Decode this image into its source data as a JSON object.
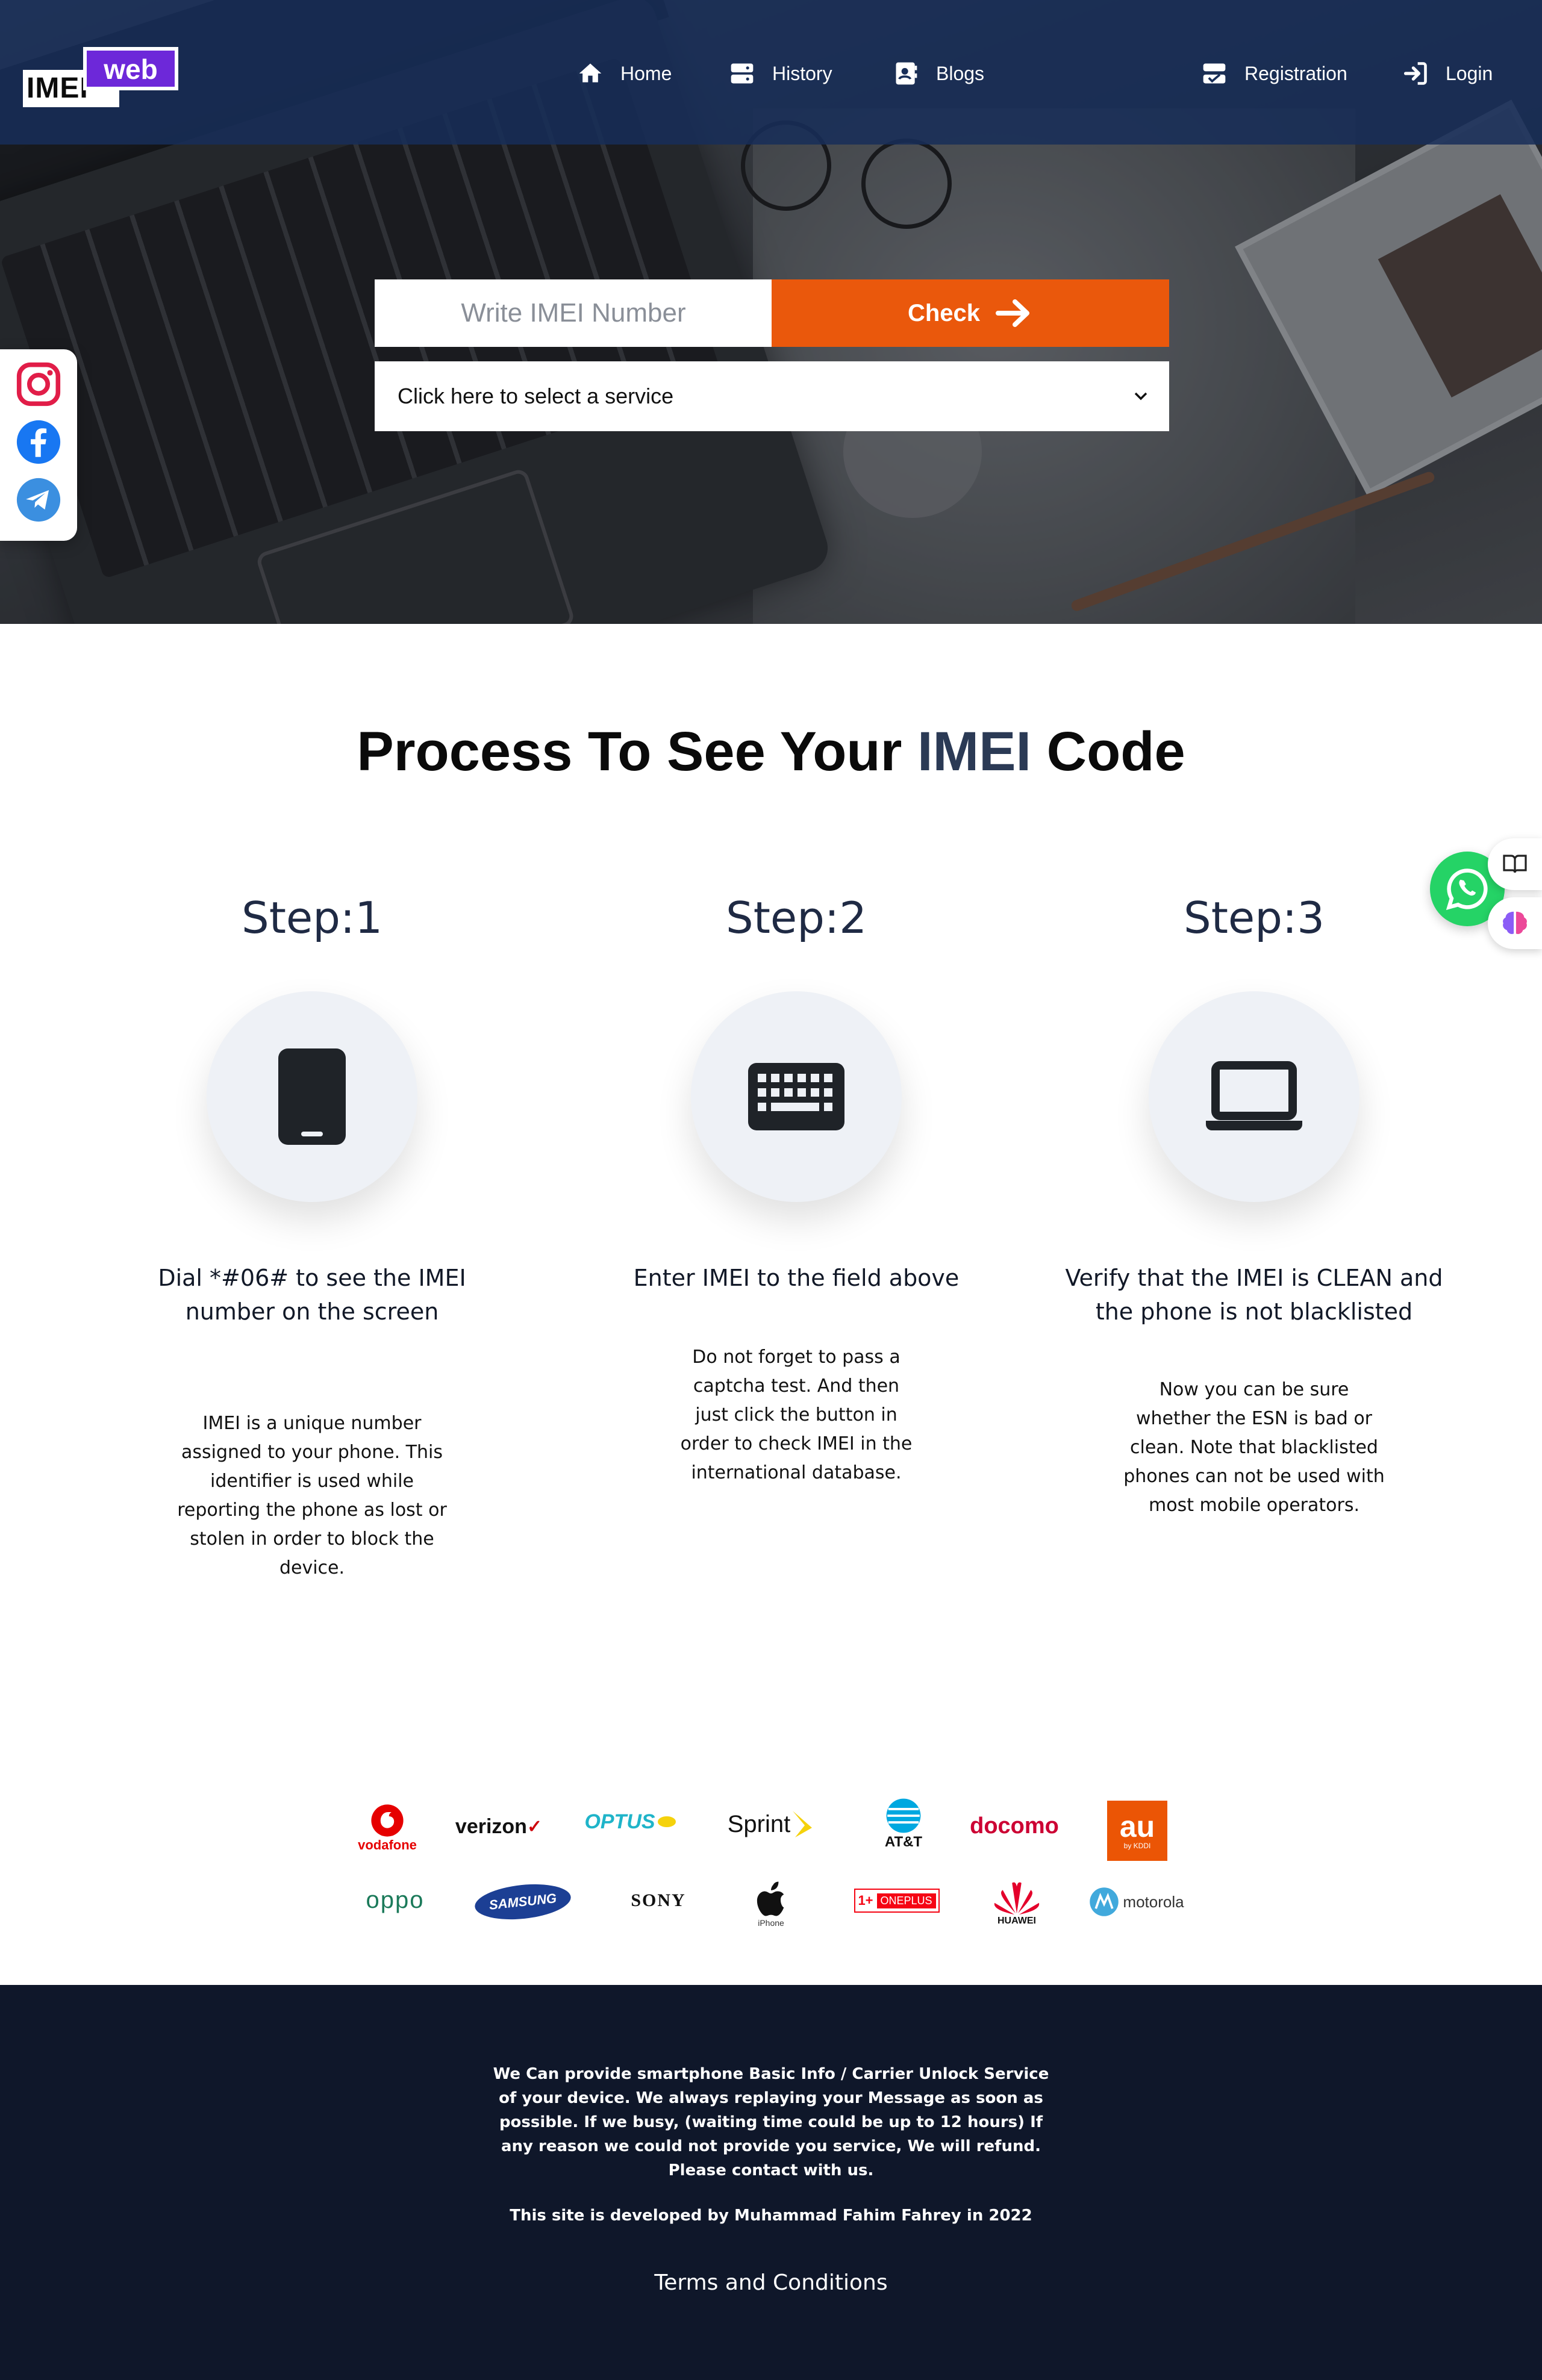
{
  "nav": {
    "logo_imei": "IMEI",
    "logo_web": "web",
    "home": "Home",
    "history": "History",
    "blogs": "Blogs",
    "registration": "Registration",
    "login": "Login"
  },
  "search": {
    "placeholder": "Write IMEI Number",
    "check_label": "Check",
    "service_placeholder": "Click here to select a service"
  },
  "social": [
    "instagram-icon",
    "facebook-icon",
    "telegram-icon"
  ],
  "process": {
    "title_pre": "Process To See Your ",
    "title_accent": "IMEI",
    "title_post": " Code",
    "steps": [
      {
        "heading": "Step:1",
        "icon": "mobile-phone-icon",
        "title": "Dial *#06# to see the IMEI number on the screen",
        "desc": "IMEI is a unique number assigned to your phone. This identifier is used while reporting the phone as lost or stolen in order to block the device."
      },
      {
        "heading": "Step:2",
        "icon": "keyboard-icon",
        "title": "Enter IMEI to the field above",
        "desc": "Do not forget to pass a captcha test. And then just click the button in order to check IMEI in the international database."
      },
      {
        "heading": "Step:3",
        "icon": "laptop-icon",
        "title": "Verify that the IMEI is CLEAN and the phone is not blacklisted",
        "desc": "Now you can be sure whether the ESN is bad or clean. Note that blacklisted phones can not be used with most mobile operators."
      }
    ]
  },
  "brands": {
    "row1": [
      "vodafone",
      "verizon",
      "OPTUS",
      "Sprint",
      "AT&T",
      "docomo",
      "au"
    ],
    "row2": [
      "oppo",
      "SAMSUNG",
      "SONY",
      "iPhone",
      "ONEPLUS",
      "HUAWEI",
      "motorola"
    ],
    "au_sub": "by KDDI"
  },
  "footer": {
    "about": "We Can provide smartphone Basic Info / Carrier Unlock Service of your device. We always replaying your Message as soon as possible. If we busy, (waiting time could be up to 12 hours) If any reason we could not provide you service, We will refund. Please contact with us.",
    "developer": "This site is developed by Muhammad Fahim Fahrey in 2022",
    "terms": "Terms and Conditions"
  },
  "colors": {
    "nav_bg": "#172d58",
    "accent_orange": "#ea580c",
    "logo_purple": "#6d28d9",
    "footer_bg": "#0f172a",
    "whatsapp_green": "#25d366"
  }
}
